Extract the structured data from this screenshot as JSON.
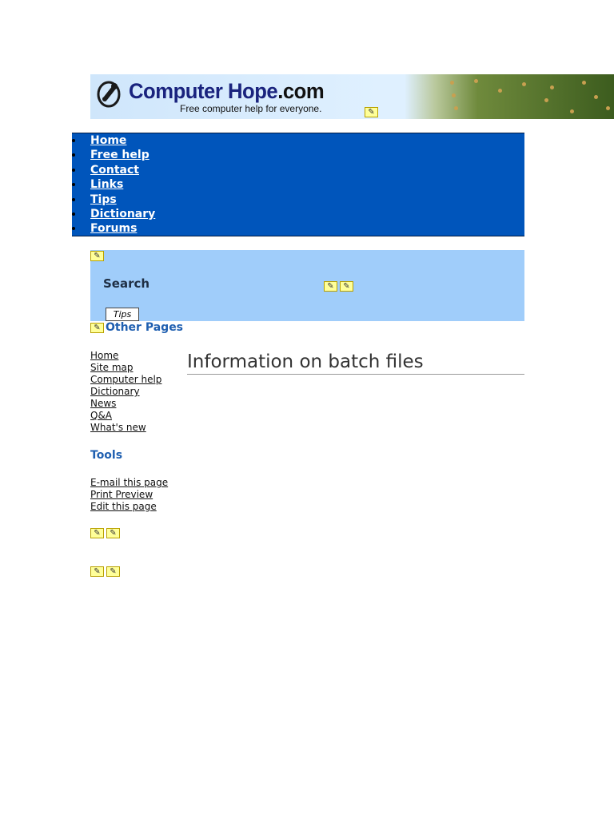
{
  "banner": {
    "logo_main": "Computer Hope",
    "logo_suffix": ".com",
    "tagline": "Free computer help for everyone."
  },
  "nav": {
    "items": [
      {
        "label": "Home"
      },
      {
        "label": "Free help"
      },
      {
        "label": "Contact"
      },
      {
        "label": "Links"
      },
      {
        "label": "Tips"
      },
      {
        "label": "Dictionary"
      },
      {
        "label": "Forums"
      }
    ]
  },
  "search": {
    "label": "Search",
    "tips_button": "Tips"
  },
  "sidebar": {
    "other_pages_heading": "Other Pages",
    "other_pages": [
      {
        "label": "Home"
      },
      {
        "label": "Site map"
      },
      {
        "label": "Computer help"
      },
      {
        "label": "Dictionary"
      },
      {
        "label": "News"
      },
      {
        "label": "Q&A"
      },
      {
        "label": "What's new"
      }
    ],
    "tools_heading": "Tools",
    "tools": [
      {
        "label": "E-mail this page"
      },
      {
        "label": "Print Preview"
      },
      {
        "label": "Edit this page"
      }
    ]
  },
  "main": {
    "title": "Information on batch files"
  },
  "colors": {
    "nav_bg": "#0055bb",
    "search_bg": "#a0cdfa",
    "heading_blue": "#1f5fb0"
  }
}
